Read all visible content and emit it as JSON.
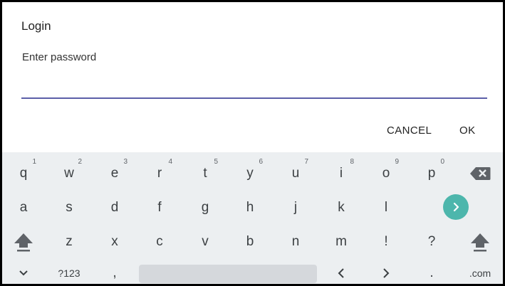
{
  "dialog": {
    "title": "Login",
    "prompt": "Enter password",
    "password_value": "",
    "cancel_label": "CANCEL",
    "ok_label": "OK"
  },
  "keyboard": {
    "row1": [
      {
        "label": "q",
        "hint": "1"
      },
      {
        "label": "w",
        "hint": "2"
      },
      {
        "label": "e",
        "hint": "3"
      },
      {
        "label": "r",
        "hint": "4"
      },
      {
        "label": "t",
        "hint": "5"
      },
      {
        "label": "y",
        "hint": "6"
      },
      {
        "label": "u",
        "hint": "7"
      },
      {
        "label": "i",
        "hint": "8"
      },
      {
        "label": "o",
        "hint": "9"
      },
      {
        "label": "p",
        "hint": "0"
      }
    ],
    "row2": [
      "a",
      "s",
      "d",
      "f",
      "g",
      "h",
      "j",
      "k",
      "l"
    ],
    "row3": [
      "z",
      "x",
      "c",
      "v",
      "b",
      "n",
      "m",
      "!",
      "?"
    ],
    "row4": {
      "symbols_label": "?123",
      "comma": ",",
      "period": ".",
      "dotcom": ".com"
    },
    "icons": {
      "backspace": "backspace-icon",
      "enter": "chevron-right-icon",
      "shift": "shift-icon",
      "hide": "chevron-down-icon",
      "left": "arrow-left-icon",
      "right": "arrow-right-icon"
    },
    "accent_color": "#4db6ac",
    "underline_color": "#5b5fa8"
  }
}
